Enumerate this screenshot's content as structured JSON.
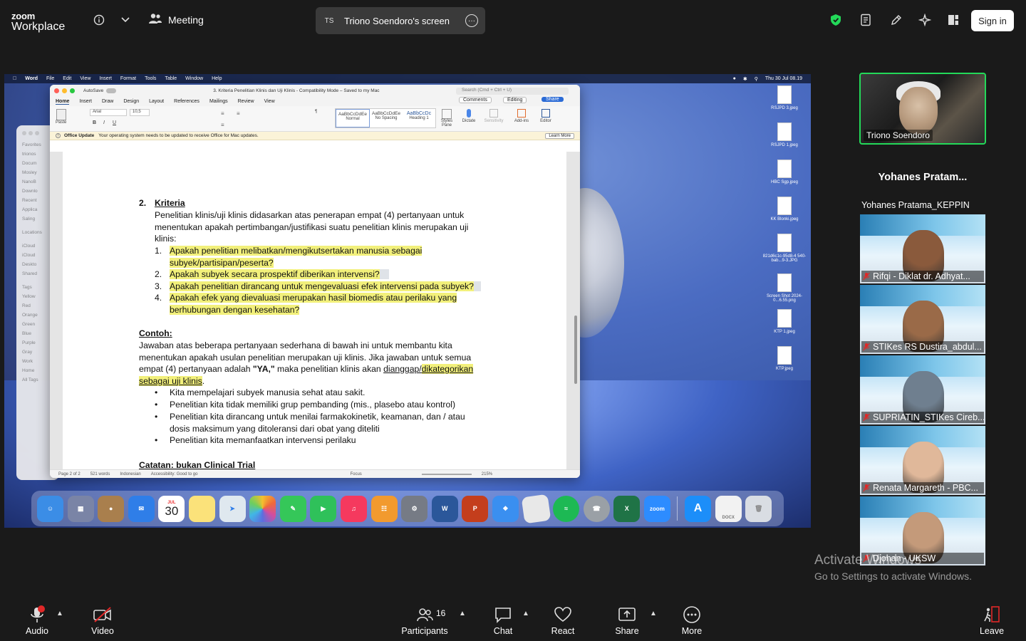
{
  "app": {
    "logo_top": "zoom",
    "logo_bottom": "Workplace"
  },
  "topbar": {
    "meeting_label": "Meeting",
    "share_pill_initials": "TS",
    "share_pill_label": "Triono Soendoro's screen",
    "signin_label": "Sign in",
    "shield_color": "#23d959"
  },
  "mac": {
    "menubar": [
      "Word",
      "File",
      "Edit",
      "View",
      "Insert",
      "Format",
      "Tools",
      "Table",
      "Window",
      "Help"
    ],
    "clock": "Thu 30 Jul  08.19"
  },
  "word": {
    "autosave": "AutoSave",
    "title": "3. Kriteria Penelitian Klinis dan Uji Klinis  -  Compatibility Mode  –  Saved to my Mac",
    "search_placeholder": "Search (Cmd + Ctrl + U)",
    "tabs": [
      "Home",
      "Insert",
      "Draw",
      "Design",
      "Layout",
      "References",
      "Mailings",
      "Review",
      "View"
    ],
    "comments_label": "Comments",
    "editing_label": "Editing",
    "share_label": "Share",
    "font_name": "Arial",
    "font_size": "10,5",
    "paste_label": "Paste",
    "styles": [
      "Normal",
      "No Spacing",
      "Heading 1"
    ],
    "ribbon_tools": [
      "Styles Pane",
      "Dictate",
      "Sensitivity",
      "Add-ins",
      "Editor"
    ],
    "update_title": "Office Update",
    "update_text": "Your operating system needs to be updated to receive Office for Mac updates.",
    "update_button": "Learn More",
    "status": {
      "page": "Page 2 of 2",
      "words": "521 words",
      "language": "Indonesian",
      "accessibility": "Accessibility: Good to go",
      "focus": "Focus",
      "zoom": "215%"
    }
  },
  "document": {
    "heading_num": "2.",
    "heading": "Kriteria",
    "intro": "Penelitian klinis/uji klinis didasarkan atas penerapan empat (4) pertanyaan untuk menentukan apakah pertimbangan/justifikasi suatu penelitian klinis merupakan uji klinis:",
    "questions": [
      {
        "num": "1.",
        "text": "Apakah penelitian melibatkan/mengikutsertakan manusia sebagai subyek/partisipan/peserta?"
      },
      {
        "num": "2.",
        "text": "Apakah subyek secara prospektif diberikan intervensi?"
      },
      {
        "num": "3.",
        "text": "Apakah penelitian dirancang untuk mengevaluasi efek intervensi pada subyek?"
      },
      {
        "num": "4.",
        "text": "Apakah efek yang dievaluasi merupakan hasil biomedis atau perilaku yang berhubungan dengan kesehatan?"
      }
    ],
    "example_heading": "Contoh",
    "example_text_a": "Jawaban atas beberapa pertanyaan sederhana di bawah ini untuk membantu kita menentukan apakah usulan penelitian merupakan uji klinis. Jika jawaban untuk semua empat (4) pertanyaan adalah ",
    "example_ya": "\"YA,\"",
    "example_text_b": " maka penelitian klinis akan ",
    "example_link1": "dianggap/",
    "example_link2": "dikategorikan sebagai uji klinis",
    "bullets": [
      "Kita mempelajari subyek manusia sehat atau sakit.",
      "Penelitian kita tidak memiliki grup pembanding (mis., plasebo atau kontrol)",
      "Penelitian kita dirancang untuk menilai farmakokinetik, keamanan, dan / atau dosis maksimum yang ditoleransi dari obat yang diteliti",
      "Penelitian kita memanfaatkan intervensi perilaku"
    ],
    "next_heading": "Catatan: bukan Clinical Trial"
  },
  "finder_sidebar": [
    "Favorites",
    "trionos",
    "Docum",
    "Mosley",
    "NanoB",
    "Downlo",
    "Recent",
    "Applica",
    "Saling",
    "Locations",
    "iCloud",
    "iCloud",
    "Deskto",
    "Shared",
    "Tags",
    "Yellow",
    "Red",
    "Orange",
    "Green",
    "Blue",
    "Purple",
    "Gray",
    "Work",
    "Home",
    "All Tags"
  ],
  "desktop_files": [
    "RSJPD 3.jpeg",
    "RSJPD 1.jpeg",
    "HBC Sgp.jpeg",
    "KK Blonki.jpeg",
    "821d6c1c-95d8-4 540-bab...9-3.JPG",
    "Screen Shot 2024-0...6.55.png",
    "KTP 1.jpeg",
    "KTP.jpeg"
  ],
  "dock": {
    "calendar_month": "JUL",
    "calendar_day": "30",
    "zoom_label": "zoom",
    "docx_label": "DOCX"
  },
  "gallery": {
    "self_name": "Triono Soendoro",
    "active_speaker": "Yohanes  Pratam...",
    "active_tile_label": "Yohanes Pratama_KEPPIN",
    "participants": [
      "Rifqi - Diklat dr. Adhyat...",
      "STIKes RS Dustira_abdul...",
      "SUPRIATIN_STIKes Cireb...",
      "Renata Margareth - PBC...",
      "Djohan - UKSW"
    ]
  },
  "watermark": {
    "line1": "Activate Windows",
    "line2": "Go to Settings to activate Windows."
  },
  "bottombar": {
    "audio": "Audio",
    "video": "Video",
    "participants": "Participants",
    "participants_count": "16",
    "chat": "Chat",
    "react": "React",
    "share": "Share",
    "more": "More",
    "leave": "Leave",
    "leave_color": "#e02828"
  }
}
